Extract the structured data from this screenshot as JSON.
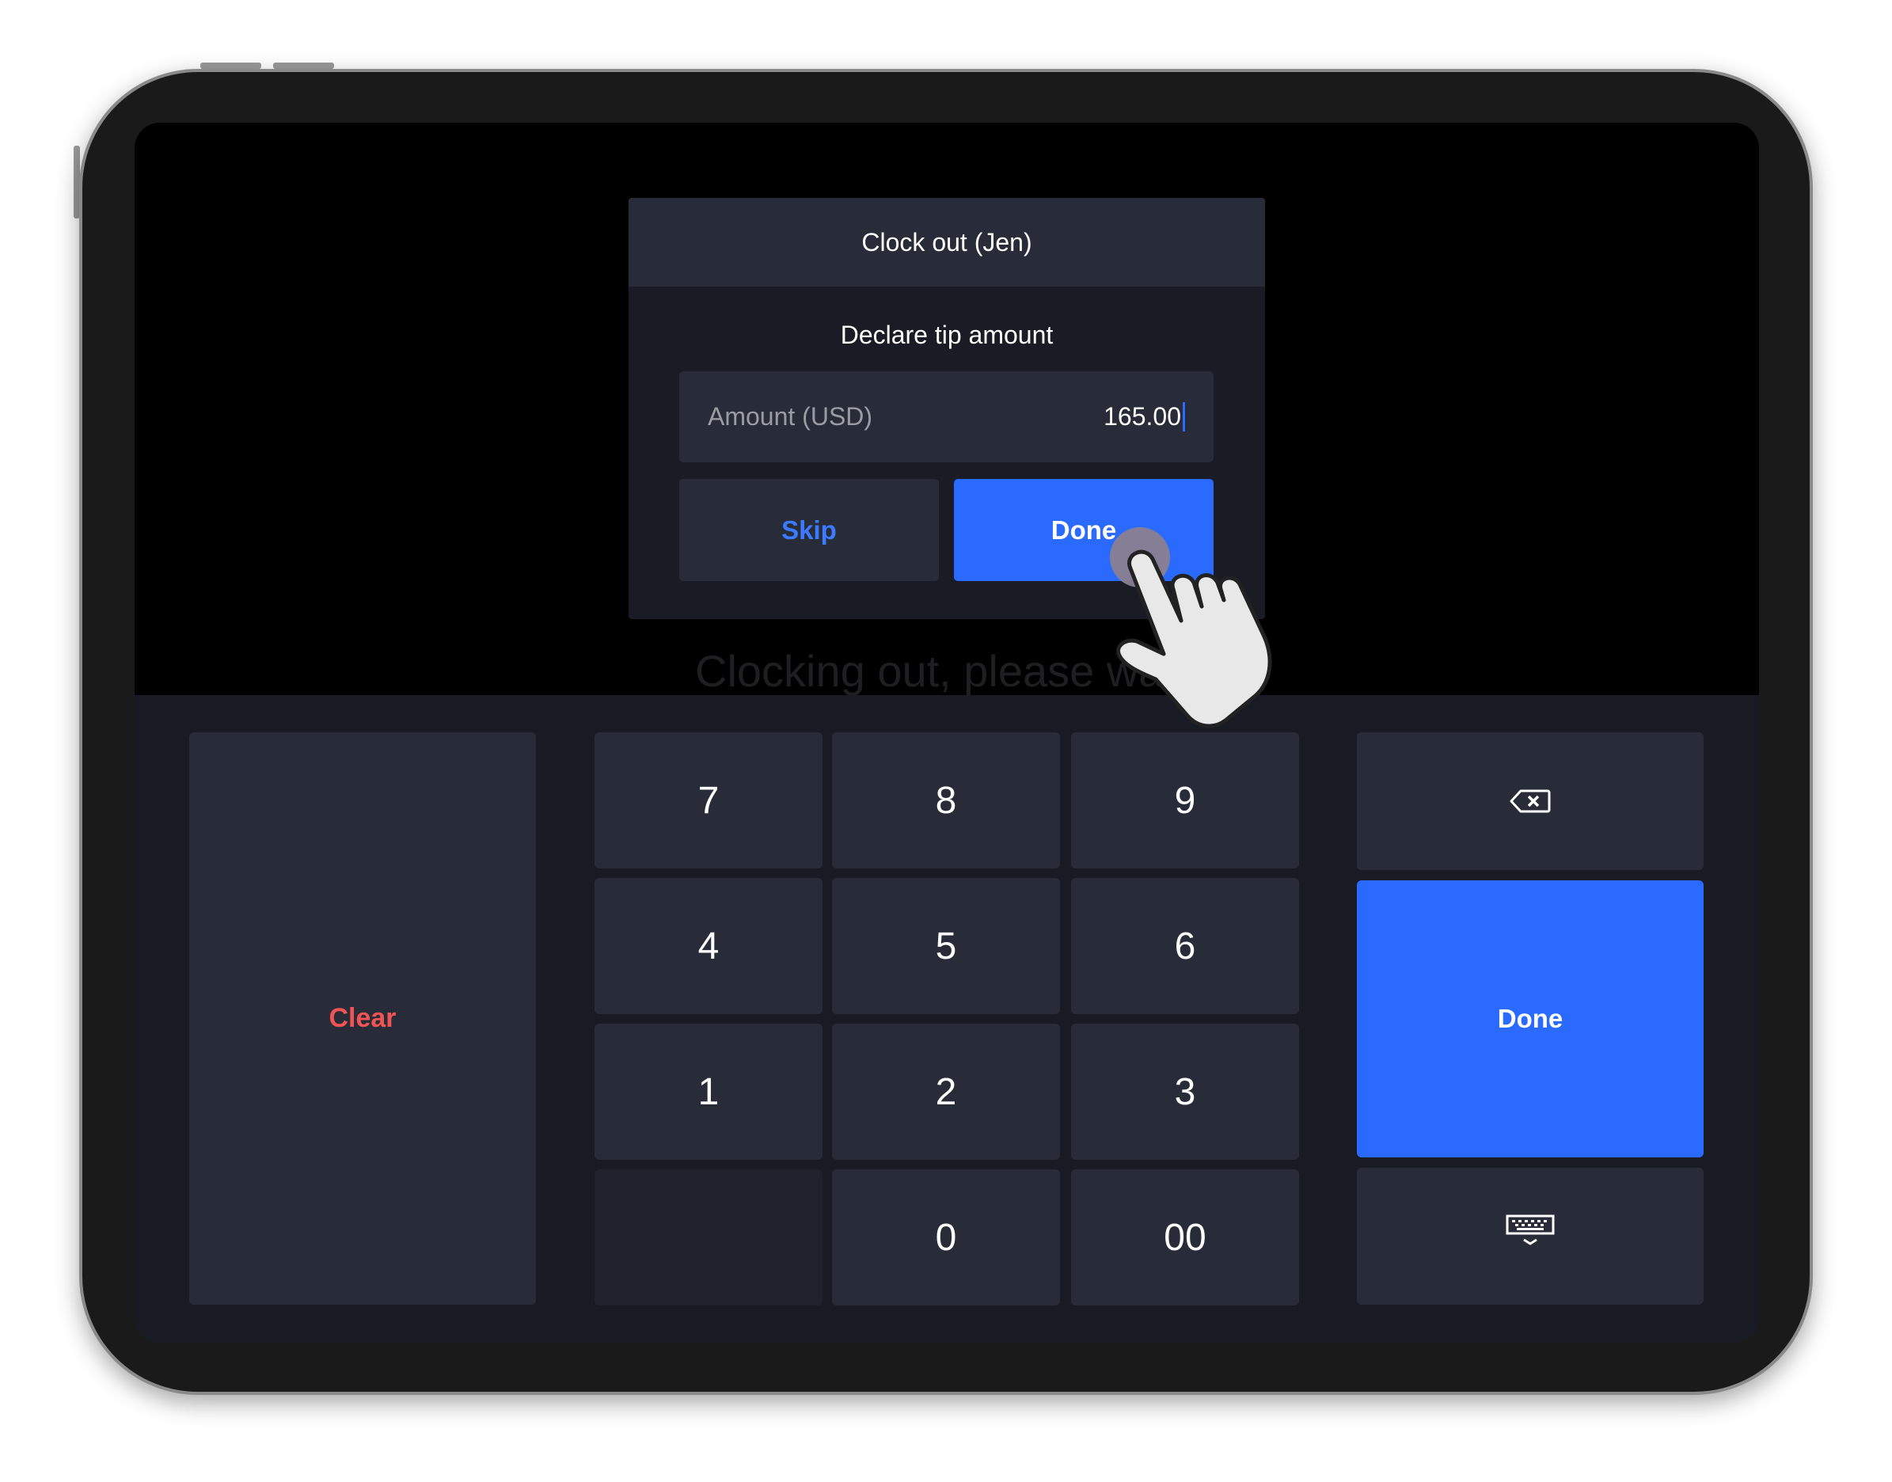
{
  "modal": {
    "title": "Clock out (Jen)",
    "subtitle": "Declare tip amount",
    "amount_label": "Amount (USD)",
    "amount_value": "165.00",
    "skip_label": "Skip",
    "done_label": "Done"
  },
  "status_text": "Clocking out, please wait...",
  "keypad": {
    "clear_label": "Clear",
    "done_label": "Done",
    "keys": [
      "7",
      "8",
      "9",
      "4",
      "5",
      "6",
      "1",
      "2",
      "3",
      "",
      "0",
      "00"
    ],
    "backspace_icon": "backspace-icon",
    "hide_keyboard_icon": "keyboard-hide-icon"
  },
  "colors": {
    "accent": "#2b6aff",
    "danger": "#f05454",
    "panel": "#282c38",
    "background": "#191b24"
  }
}
